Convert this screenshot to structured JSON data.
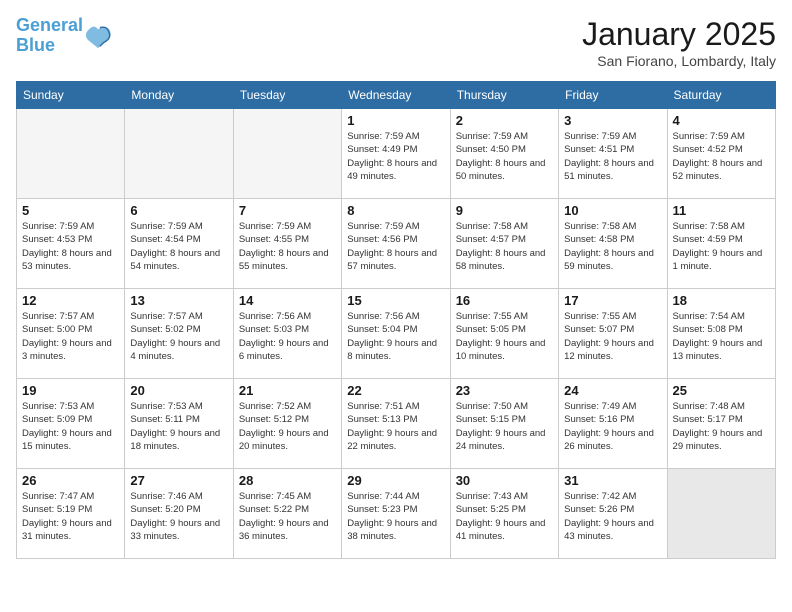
{
  "header": {
    "logo_line1": "General",
    "logo_line2": "Blue",
    "month": "January 2025",
    "location": "San Fiorano, Lombardy, Italy"
  },
  "days_of_week": [
    "Sunday",
    "Monday",
    "Tuesday",
    "Wednesday",
    "Thursday",
    "Friday",
    "Saturday"
  ],
  "weeks": [
    [
      {
        "day": "",
        "empty": true
      },
      {
        "day": "",
        "empty": true
      },
      {
        "day": "",
        "empty": true
      },
      {
        "day": "1",
        "sunrise": "7:59 AM",
        "sunset": "4:49 PM",
        "daylight": "8 hours and 49 minutes."
      },
      {
        "day": "2",
        "sunrise": "7:59 AM",
        "sunset": "4:50 PM",
        "daylight": "8 hours and 50 minutes."
      },
      {
        "day": "3",
        "sunrise": "7:59 AM",
        "sunset": "4:51 PM",
        "daylight": "8 hours and 51 minutes."
      },
      {
        "day": "4",
        "sunrise": "7:59 AM",
        "sunset": "4:52 PM",
        "daylight": "8 hours and 52 minutes."
      }
    ],
    [
      {
        "day": "5",
        "sunrise": "7:59 AM",
        "sunset": "4:53 PM",
        "daylight": "8 hours and 53 minutes."
      },
      {
        "day": "6",
        "sunrise": "7:59 AM",
        "sunset": "4:54 PM",
        "daylight": "8 hours and 54 minutes."
      },
      {
        "day": "7",
        "sunrise": "7:59 AM",
        "sunset": "4:55 PM",
        "daylight": "8 hours and 55 minutes."
      },
      {
        "day": "8",
        "sunrise": "7:59 AM",
        "sunset": "4:56 PM",
        "daylight": "8 hours and 57 minutes."
      },
      {
        "day": "9",
        "sunrise": "7:58 AM",
        "sunset": "4:57 PM",
        "daylight": "8 hours and 58 minutes."
      },
      {
        "day": "10",
        "sunrise": "7:58 AM",
        "sunset": "4:58 PM",
        "daylight": "8 hours and 59 minutes."
      },
      {
        "day": "11",
        "sunrise": "7:58 AM",
        "sunset": "4:59 PM",
        "daylight": "9 hours and 1 minute."
      }
    ],
    [
      {
        "day": "12",
        "sunrise": "7:57 AM",
        "sunset": "5:00 PM",
        "daylight": "9 hours and 3 minutes."
      },
      {
        "day": "13",
        "sunrise": "7:57 AM",
        "sunset": "5:02 PM",
        "daylight": "9 hours and 4 minutes."
      },
      {
        "day": "14",
        "sunrise": "7:56 AM",
        "sunset": "5:03 PM",
        "daylight": "9 hours and 6 minutes."
      },
      {
        "day": "15",
        "sunrise": "7:56 AM",
        "sunset": "5:04 PM",
        "daylight": "9 hours and 8 minutes."
      },
      {
        "day": "16",
        "sunrise": "7:55 AM",
        "sunset": "5:05 PM",
        "daylight": "9 hours and 10 minutes."
      },
      {
        "day": "17",
        "sunrise": "7:55 AM",
        "sunset": "5:07 PM",
        "daylight": "9 hours and 12 minutes."
      },
      {
        "day": "18",
        "sunrise": "7:54 AM",
        "sunset": "5:08 PM",
        "daylight": "9 hours and 13 minutes."
      }
    ],
    [
      {
        "day": "19",
        "sunrise": "7:53 AM",
        "sunset": "5:09 PM",
        "daylight": "9 hours and 15 minutes."
      },
      {
        "day": "20",
        "sunrise": "7:53 AM",
        "sunset": "5:11 PM",
        "daylight": "9 hours and 18 minutes."
      },
      {
        "day": "21",
        "sunrise": "7:52 AM",
        "sunset": "5:12 PM",
        "daylight": "9 hours and 20 minutes."
      },
      {
        "day": "22",
        "sunrise": "7:51 AM",
        "sunset": "5:13 PM",
        "daylight": "9 hours and 22 minutes."
      },
      {
        "day": "23",
        "sunrise": "7:50 AM",
        "sunset": "5:15 PM",
        "daylight": "9 hours and 24 minutes."
      },
      {
        "day": "24",
        "sunrise": "7:49 AM",
        "sunset": "5:16 PM",
        "daylight": "9 hours and 26 minutes."
      },
      {
        "day": "25",
        "sunrise": "7:48 AM",
        "sunset": "5:17 PM",
        "daylight": "9 hours and 29 minutes."
      }
    ],
    [
      {
        "day": "26",
        "sunrise": "7:47 AM",
        "sunset": "5:19 PM",
        "daylight": "9 hours and 31 minutes."
      },
      {
        "day": "27",
        "sunrise": "7:46 AM",
        "sunset": "5:20 PM",
        "daylight": "9 hours and 33 minutes."
      },
      {
        "day": "28",
        "sunrise": "7:45 AM",
        "sunset": "5:22 PM",
        "daylight": "9 hours and 36 minutes."
      },
      {
        "day": "29",
        "sunrise": "7:44 AM",
        "sunset": "5:23 PM",
        "daylight": "9 hours and 38 minutes."
      },
      {
        "day": "30",
        "sunrise": "7:43 AM",
        "sunset": "5:25 PM",
        "daylight": "9 hours and 41 minutes."
      },
      {
        "day": "31",
        "sunrise": "7:42 AM",
        "sunset": "5:26 PM",
        "daylight": "9 hours and 43 minutes."
      },
      {
        "day": "",
        "empty": true
      }
    ]
  ]
}
